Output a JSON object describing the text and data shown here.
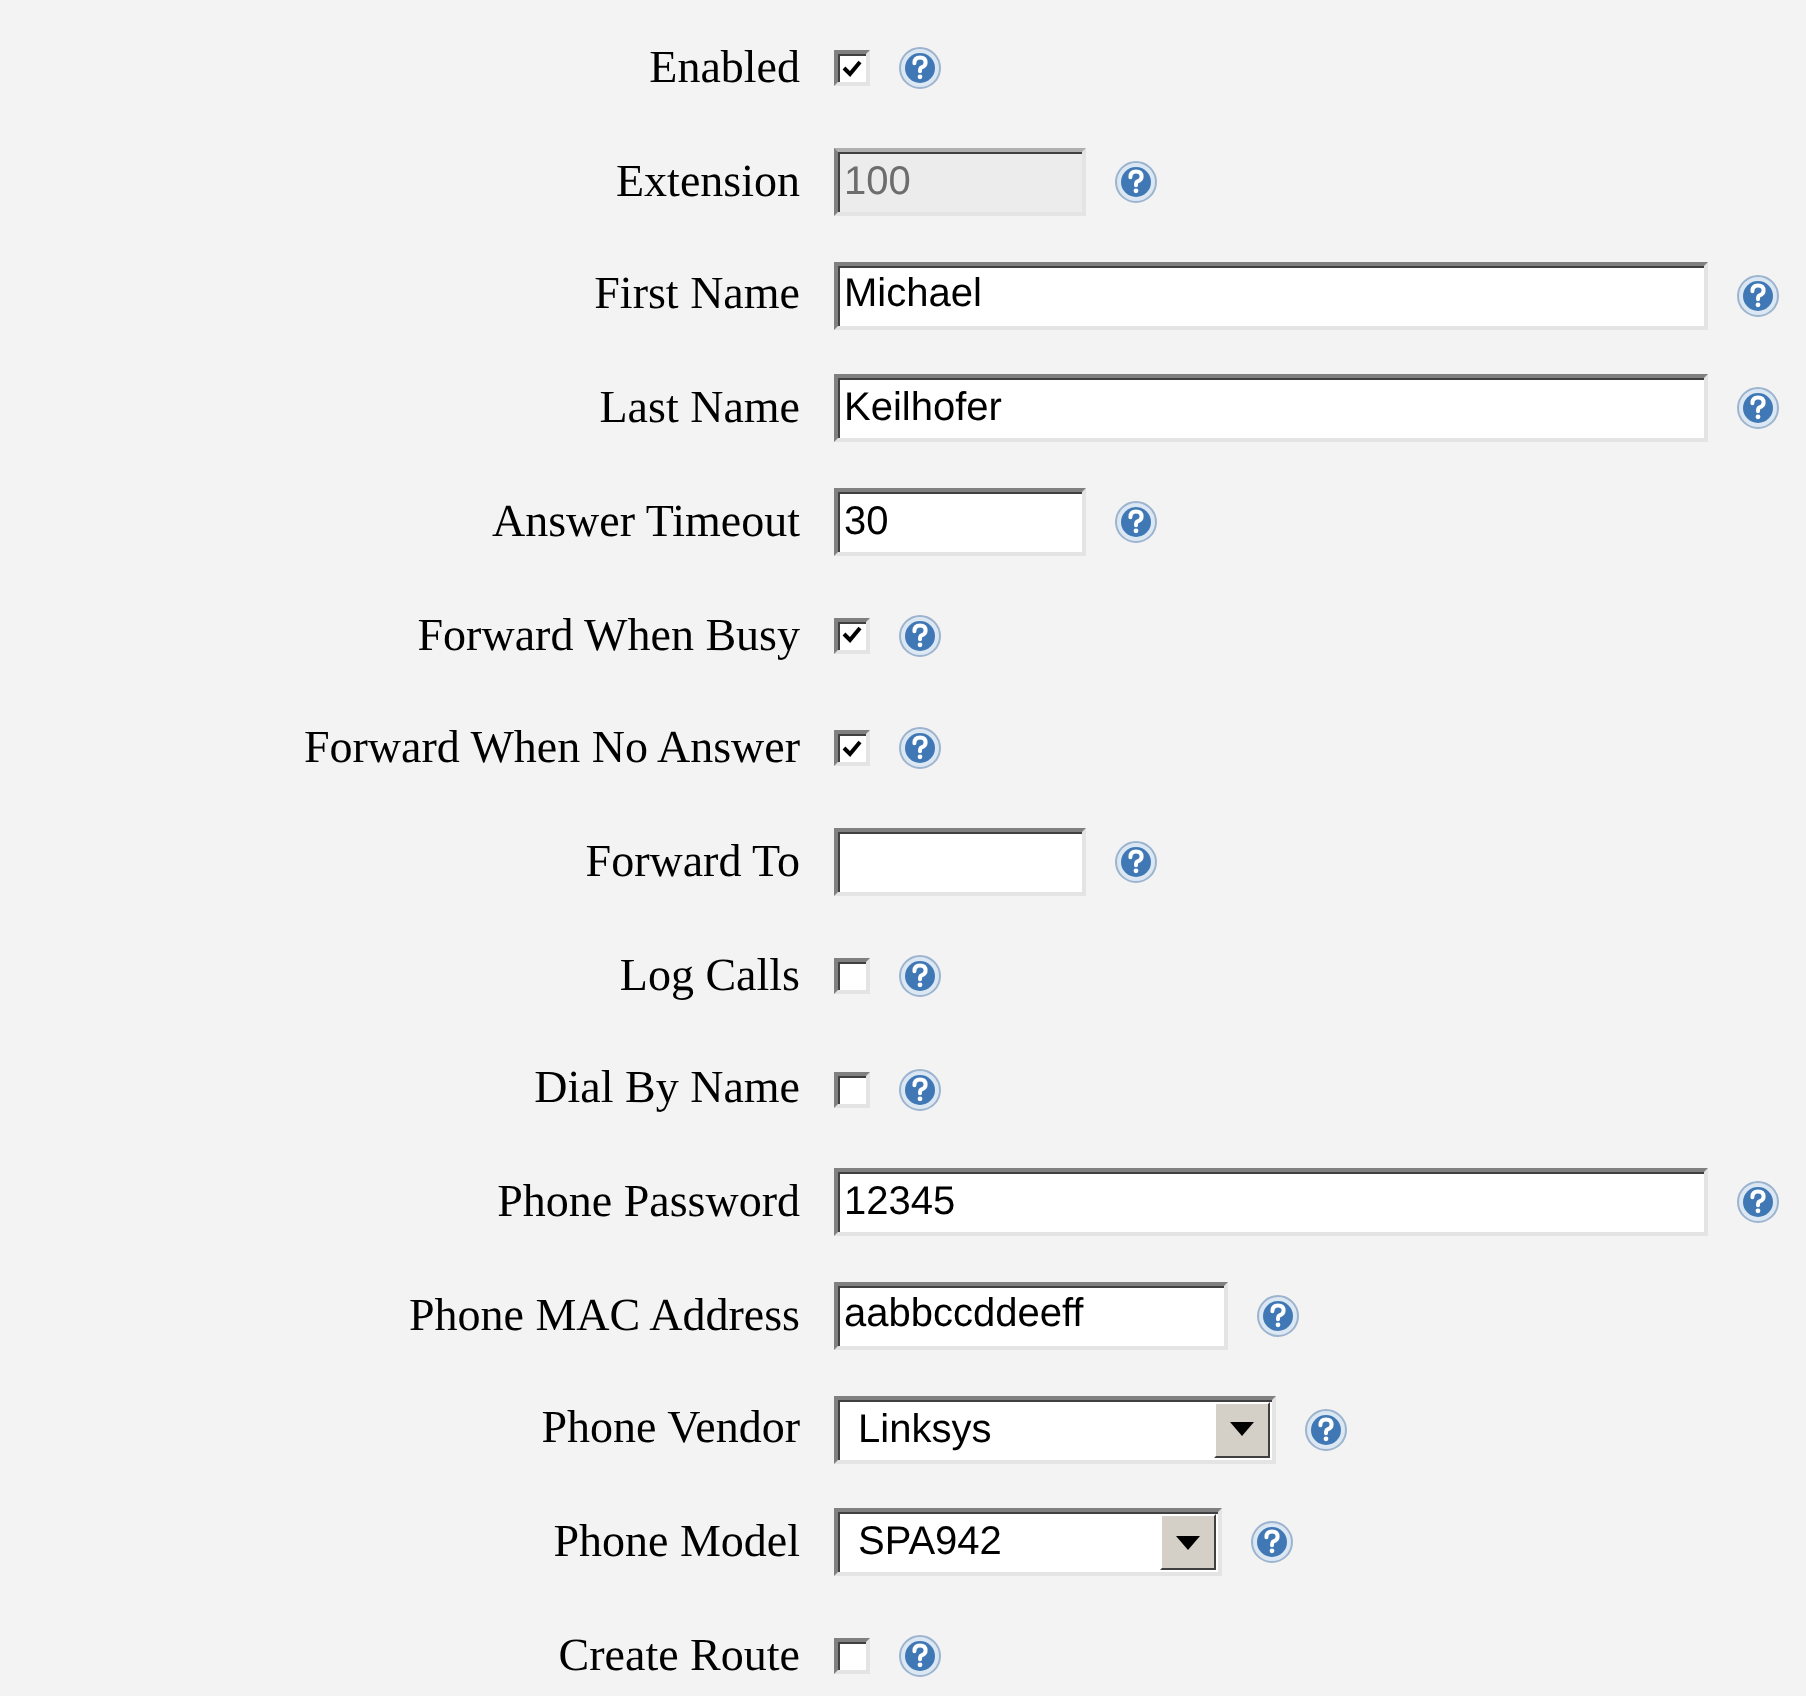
{
  "fields": [
    {
      "label": "Enabled",
      "kind": "checkbox",
      "checked": true
    },
    {
      "label": "Extension",
      "kind": "short_text",
      "value": "100",
      "disabled": true
    },
    {
      "label": "First Name",
      "kind": "long_text",
      "value": "Michael",
      "disabled": false
    },
    {
      "label": "Last Name",
      "kind": "long_text",
      "value": "Keilhofer",
      "disabled": false
    },
    {
      "label": "Answer Timeout",
      "kind": "short_text",
      "value": "30",
      "disabled": false
    },
    {
      "label": "Forward When Busy",
      "kind": "checkbox",
      "checked": true
    },
    {
      "label": "Forward When No Answer",
      "kind": "checkbox",
      "checked": true
    },
    {
      "label": "Forward To",
      "kind": "short_text",
      "disabled": false
    },
    {
      "label": "Log Calls",
      "kind": "checkbox",
      "checked": false
    },
    {
      "label": "Dial By Name",
      "kind": "checkbox",
      "checked": false
    },
    {
      "label": "Phone Password",
      "kind": "long_text",
      "value": "12345",
      "disabled": false
    },
    {
      "label": "Phone MAC Address",
      "kind": "medium_text",
      "value": "aabbccddeeff",
      "disabled": false
    },
    {
      "label": "Phone Vendor",
      "kind": "wide_select",
      "value": "Linksys"
    },
    {
      "label": "Phone Model",
      "kind": "medium_select",
      "value": "SPA942"
    },
    {
      "label": "Create Route",
      "kind": "checkbox",
      "checked": false
    }
  ]
}
